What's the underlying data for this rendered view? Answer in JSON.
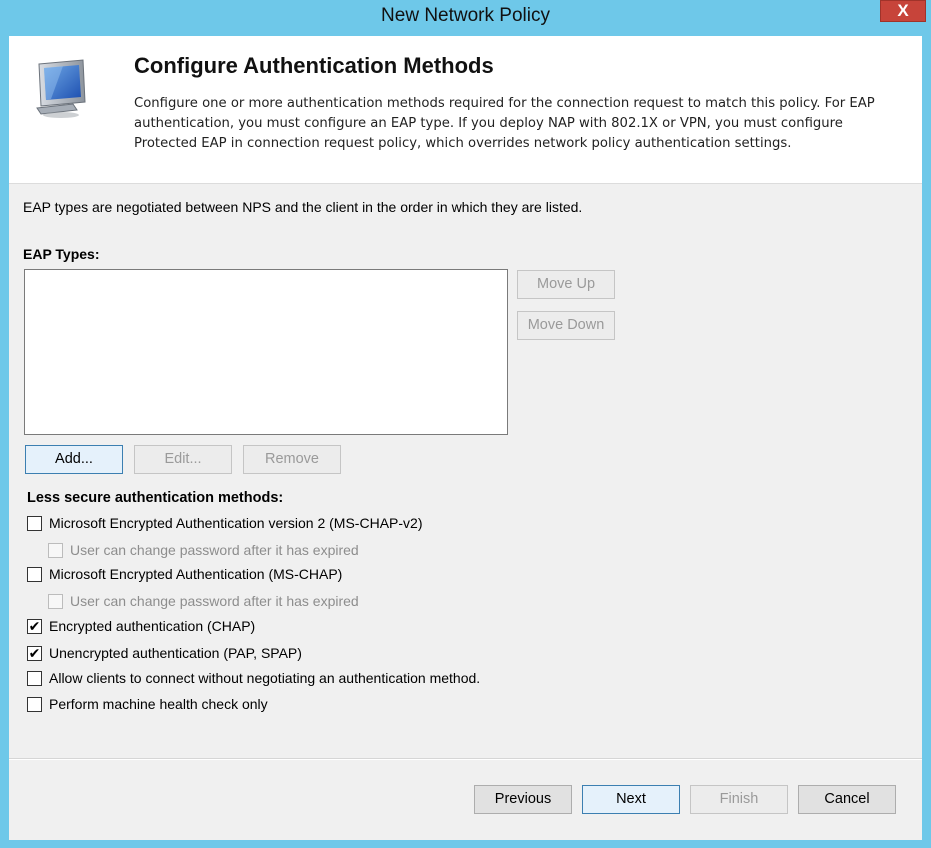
{
  "window": {
    "title": "New Network Policy",
    "close_glyph": "X"
  },
  "header": {
    "icon": "monitor-icon",
    "title": "Configure Authentication Methods",
    "description": "Configure one or more authentication methods required for the connection request to match this policy. For EAP authentication, you must configure an EAP type. If you deploy NAP with 802.1X or VPN, you must configure Protected EAP in connection request policy, which overrides network policy authentication settings."
  },
  "eap": {
    "intro": "EAP types are negotiated between NPS and the client in the order in which they are listed.",
    "label": "EAP Types:",
    "items": [],
    "move_up": "Move Up",
    "move_down": "Move Down",
    "add": "Add...",
    "edit": "Edit...",
    "remove": "Remove"
  },
  "less_secure": {
    "label": "Less secure authentication methods:",
    "options": [
      {
        "label": "Microsoft Encrypted Authentication version 2 (MS-CHAP-v2)",
        "checked": false,
        "enabled": true
      },
      {
        "label": "User can change password after it has expired",
        "checked": false,
        "enabled": false
      },
      {
        "label": "Microsoft Encrypted Authentication (MS-CHAP)",
        "checked": false,
        "enabled": true
      },
      {
        "label": "User can change password after it has expired",
        "checked": false,
        "enabled": false
      },
      {
        "label": "Encrypted authentication (CHAP)",
        "checked": true,
        "enabled": true
      },
      {
        "label": "Unencrypted authentication (PAP, SPAP)",
        "checked": true,
        "enabled": true
      },
      {
        "label": "Allow clients to connect without negotiating an authentication method.",
        "checked": false,
        "enabled": true
      },
      {
        "label": "Perform machine health check only",
        "checked": false,
        "enabled": true
      }
    ]
  },
  "footer": {
    "previous": "Previous",
    "next": "Next",
    "finish": "Finish",
    "cancel": "Cancel"
  },
  "colors": {
    "frame": "#6ec8e9",
    "close_button": "#c7443a",
    "dialog_bg": "#f0f0f0",
    "focus_border": "#3c7fb1"
  }
}
